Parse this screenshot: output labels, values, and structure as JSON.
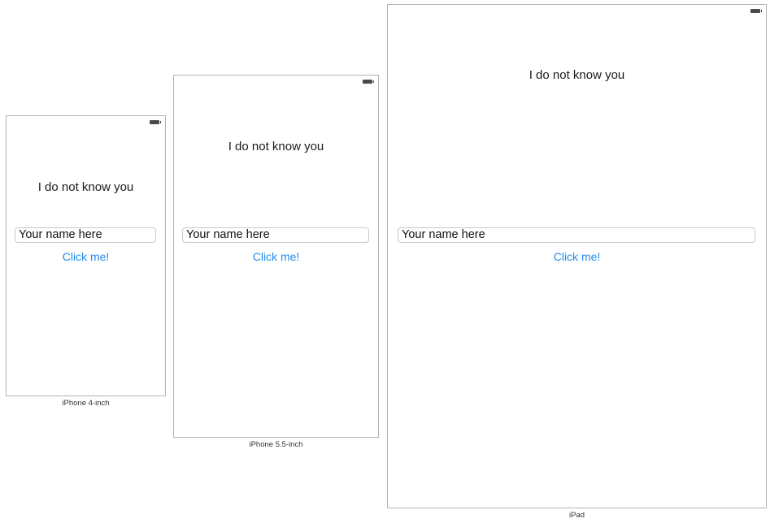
{
  "devices": [
    {
      "caption": "iPhone 4-inch",
      "greeting": "I do not know you",
      "name_placeholder": "Your name here",
      "button_label": "Click me!"
    },
    {
      "caption": "iPhone 5.5-inch",
      "greeting": "I do not know you",
      "name_placeholder": "Your name here",
      "button_label": "Click me!"
    },
    {
      "caption": "iPad",
      "greeting": "I do not know you",
      "name_placeholder": "Your name here",
      "button_label": "Click me!"
    }
  ],
  "colors": {
    "button_text": "#1f8bf0",
    "device_border": "#b3b3b3"
  },
  "icons": {
    "status_bar": "battery-icon"
  }
}
